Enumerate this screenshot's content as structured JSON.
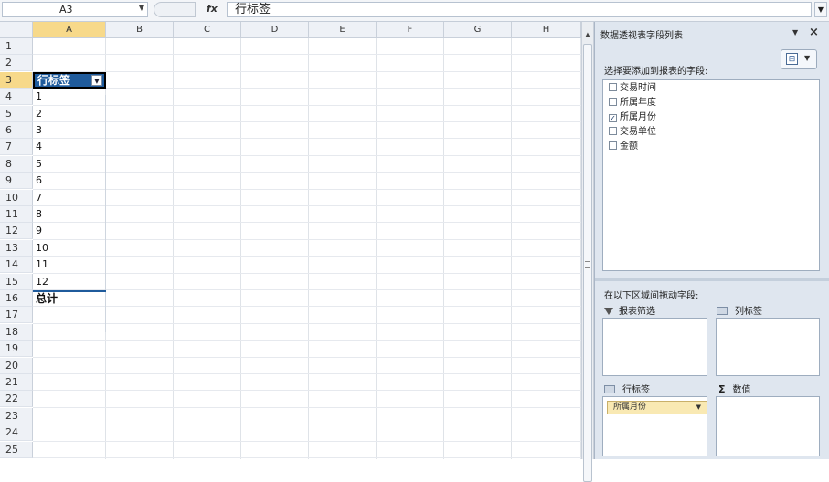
{
  "formula_bar": {
    "name_box": "A3",
    "fx_symbol": "fx",
    "content": "行标签"
  },
  "grid": {
    "columns": [
      "A",
      "B",
      "C",
      "D",
      "E",
      "F",
      "G",
      "H"
    ],
    "selected_column": "A",
    "rows": [
      "1",
      "2",
      "3",
      "4",
      "5",
      "6",
      "7",
      "8",
      "9",
      "10",
      "11",
      "12",
      "13",
      "14",
      "15",
      "16",
      "17",
      "18",
      "19",
      "20",
      "21",
      "22",
      "23",
      "24",
      "25"
    ],
    "selected_row": "3",
    "pivot": {
      "header": "行标签",
      "items": [
        "1",
        "2",
        "3",
        "4",
        "5",
        "6",
        "7",
        "8",
        "9",
        "10",
        "11",
        "12"
      ],
      "total": "总计"
    }
  },
  "pane": {
    "title": "数据透视表字段列表",
    "choose_label": "选择要添加到报表的字段:",
    "fields": [
      {
        "label": "交易时间",
        "checked": false
      },
      {
        "label": "所属年度",
        "checked": false
      },
      {
        "label": "所属月份",
        "checked": true
      },
      {
        "label": "交易单位",
        "checked": false
      },
      {
        "label": "金额",
        "checked": false
      }
    ],
    "drag_label": "在以下区域间拖动字段:",
    "areas": {
      "filter": "报表筛选",
      "columns": "列标签",
      "rows": "行标签",
      "values": "数值"
    },
    "row_field": "所属月份",
    "check_mark": "✓",
    "dropdown_glyph": "▼"
  }
}
